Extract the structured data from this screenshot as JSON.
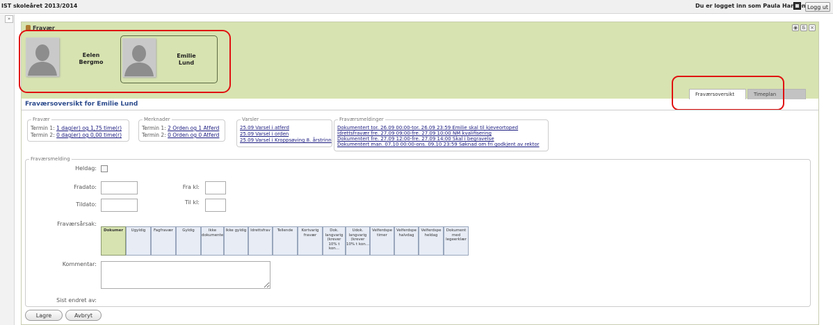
{
  "app": {
    "title": "IST skoleåret 2013/2014",
    "user_text": "Du er logget inn som Paula Hansen",
    "logout_label": "Logg ut",
    "expand_glyph": "»"
  },
  "panel": {
    "title": "Fravær",
    "controls": [
      "◉",
      "Б",
      "×"
    ]
  },
  "students": [
    {
      "first": "Eelen",
      "last": "Bergmo",
      "selected": false
    },
    {
      "first": "Emilie",
      "last": "Lund",
      "selected": true
    }
  ],
  "tabs": [
    {
      "label": "Fraværsoversikt",
      "active": true
    },
    {
      "label": "Timeplan",
      "active": false
    }
  ],
  "overview": {
    "title": "Fraværsoversikt for Emilie Lund",
    "fravaer": {
      "legend": "Fravær",
      "rows": [
        {
          "prefix": "Termin 1:",
          "link": "1 dag(er) og 1,75 time(r)"
        },
        {
          "prefix": "Termin 2:",
          "link": "0 dag(er) og 0,00 time(r)"
        }
      ]
    },
    "merknader": {
      "legend": "Merknader",
      "rows": [
        {
          "prefix": "Termin 1:",
          "link": "2 Orden og 1 Atferd"
        },
        {
          "prefix": "Termin 2:",
          "link": "0 Orden og 0 Atferd"
        }
      ]
    },
    "varsler": {
      "legend": "Varsler",
      "items": [
        "25.09 Varsel i atferd",
        "25.09 Varsel i orden",
        "25.09 Varsel i Kroppsøving 8. årstrinn"
      ]
    },
    "fravaersmeldinger": {
      "legend": "Fraværsmeldinger",
      "items": [
        "Dokumentert tor. 26.09 00:00-tor. 26.09 23:59 Emilie skal til kjeveortoped",
        "Idrettsfravær fre. 27.09 09:00-fre. 27.09 10:00 NM kvalifisering",
        "Dokumentert fre. 27.09 12:00-fre. 27.09 14:00 Skal i begravelse",
        "Dokumentert man. 07.10 00:00-ons. 09.10 23:59 Søknad om fri godkjent av rektor"
      ]
    }
  },
  "form": {
    "legend": "Fraværsmelding",
    "heldag_label": "Heldag:",
    "fradato_label": "Fradato:",
    "fra_kl_label": "Fra kl:",
    "tildato_label": "Tildato:",
    "til_kl_label": "Til kl:",
    "arsak_label": "Fraværsårsak:",
    "kommentar_label": "Kommentar:",
    "sist_endret_label": "Sist endret av:",
    "fradato_value": "",
    "fra_kl_value": "",
    "tildato_value": "",
    "til_kl_value": "",
    "kommentar_value": "",
    "reasons": [
      {
        "label": "Dokumer",
        "selected": true
      },
      {
        "label": "Ugyldig",
        "selected": false
      },
      {
        "label": "Fagfravær",
        "selected": false
      },
      {
        "label": "Gyldig",
        "selected": false
      },
      {
        "label": "Ikke dokumente",
        "selected": false
      },
      {
        "label": "Ikke gyldig",
        "selected": false
      },
      {
        "label": "Idrettsfrav",
        "selected": false
      },
      {
        "label": "Tellende",
        "selected": false
      },
      {
        "label": "Kortvarig fravær",
        "selected": false
      },
      {
        "label": "Dok. langvarig (krever 10% t kon...",
        "selected": false
      },
      {
        "label": "Udok. langvarig (krever 10% t kon...",
        "selected": false
      },
      {
        "label": "Velferdspe timer",
        "selected": false
      },
      {
        "label": "Velferdspe halvdag",
        "selected": false
      },
      {
        "label": "Velferdspe heldag",
        "selected": false
      },
      {
        "label": "Dokument med legeerklær",
        "selected": false
      }
    ]
  },
  "actions": {
    "save_label": "Lagre",
    "cancel_label": "Avbryt"
  },
  "colors": {
    "header_green": "#d7e3b0",
    "highlight_red": "#e01010",
    "section_title_blue": "#2b4a8c",
    "reason_selected": "#d7e3b0",
    "reason_default": "#e7ecf5"
  }
}
